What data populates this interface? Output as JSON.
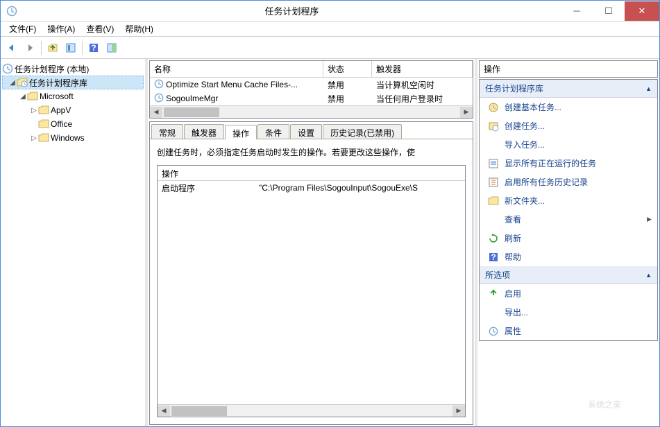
{
  "window": {
    "title": "任务计划程序"
  },
  "menu": {
    "file": "文件(F)",
    "action": "操作(A)",
    "view": "查看(V)",
    "help": "帮助(H)"
  },
  "tree": {
    "root": "任务计划程序 (本地)",
    "lib": "任务计划程序库",
    "ms": "Microsoft",
    "appv": "AppV",
    "office": "Office",
    "windows": "Windows"
  },
  "taskList": {
    "headers": {
      "name": "名称",
      "status": "状态",
      "trigger": "触发器"
    },
    "rows": [
      {
        "name": "Optimize Start Menu Cache Files-...",
        "status": "禁用",
        "trigger": "当计算机空闲时"
      },
      {
        "name": "SogouImeMgr",
        "status": "禁用",
        "trigger": "当任何用户登录时"
      }
    ]
  },
  "tabs": {
    "general": "常规",
    "triggers": "触发器",
    "actions": "操作",
    "conditions": "条件",
    "settings": "设置",
    "history": "历史记录(已禁用)"
  },
  "detail": {
    "desc": "创建任务时，必须指定任务启动时发生的操作。若要更改这些操作，使",
    "opHeader": "操作",
    "opRows": [
      {
        "action": "启动程序",
        "detail": "\"C:\\Program Files\\SogouInput\\SogouExe\\S"
      }
    ]
  },
  "actions": {
    "title": "操作",
    "section1": "任务计划程序库",
    "createBasic": "创建基本任务...",
    "createTask": "创建任务...",
    "importTask": "导入任务...",
    "showRunning": "显示所有正在运行的任务",
    "enableHistory": "启用所有任务历史记录",
    "newFolder": "新文件夹...",
    "view": "查看",
    "refresh": "刷新",
    "help": "帮助",
    "section2": "所选项",
    "enable": "启用",
    "export": "导出...",
    "properties": "属性"
  },
  "watermark": "系统之家",
  "colors": {
    "accent": "#15428b",
    "sectionBg": "#e8eef7",
    "close": "#c75050"
  }
}
